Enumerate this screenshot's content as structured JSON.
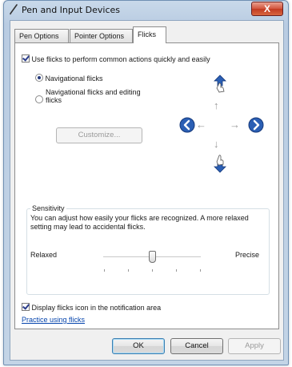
{
  "window": {
    "title": "Pen and Input Devices",
    "close_glyph": "X"
  },
  "tabs": [
    {
      "label": "Pen Options"
    },
    {
      "label": "Pointer Options"
    },
    {
      "label": "Flicks"
    }
  ],
  "flicks": {
    "use_flicks": {
      "label": "Use flicks to perform common actions quickly and easily",
      "checked": true
    },
    "mode_options": [
      {
        "label": "Navigational flicks",
        "selected": true
      },
      {
        "label": "Navigational flicks and editing flicks",
        "selected": false
      }
    ],
    "customize_label": "Customize..."
  },
  "sensitivity": {
    "title": "Sensitivity",
    "description": "You can adjust how easily your flicks are recognized. A more relaxed setting may lead to accidental flicks.",
    "min_label": "Relaxed",
    "max_label": "Precise",
    "level": 0.5
  },
  "notification": {
    "label": "Display flicks icon in the notification area",
    "checked": true
  },
  "practice_link": "Practice using flicks",
  "footer": {
    "ok": "OK",
    "cancel": "Cancel",
    "apply": "Apply"
  },
  "colors": {
    "accent_blue": "#2b5fb4",
    "link": "#0645ad"
  },
  "icons": [
    "pen-icon",
    "flick-up-icon",
    "flick-down-icon",
    "flick-left-icon",
    "flick-right-icon"
  ]
}
